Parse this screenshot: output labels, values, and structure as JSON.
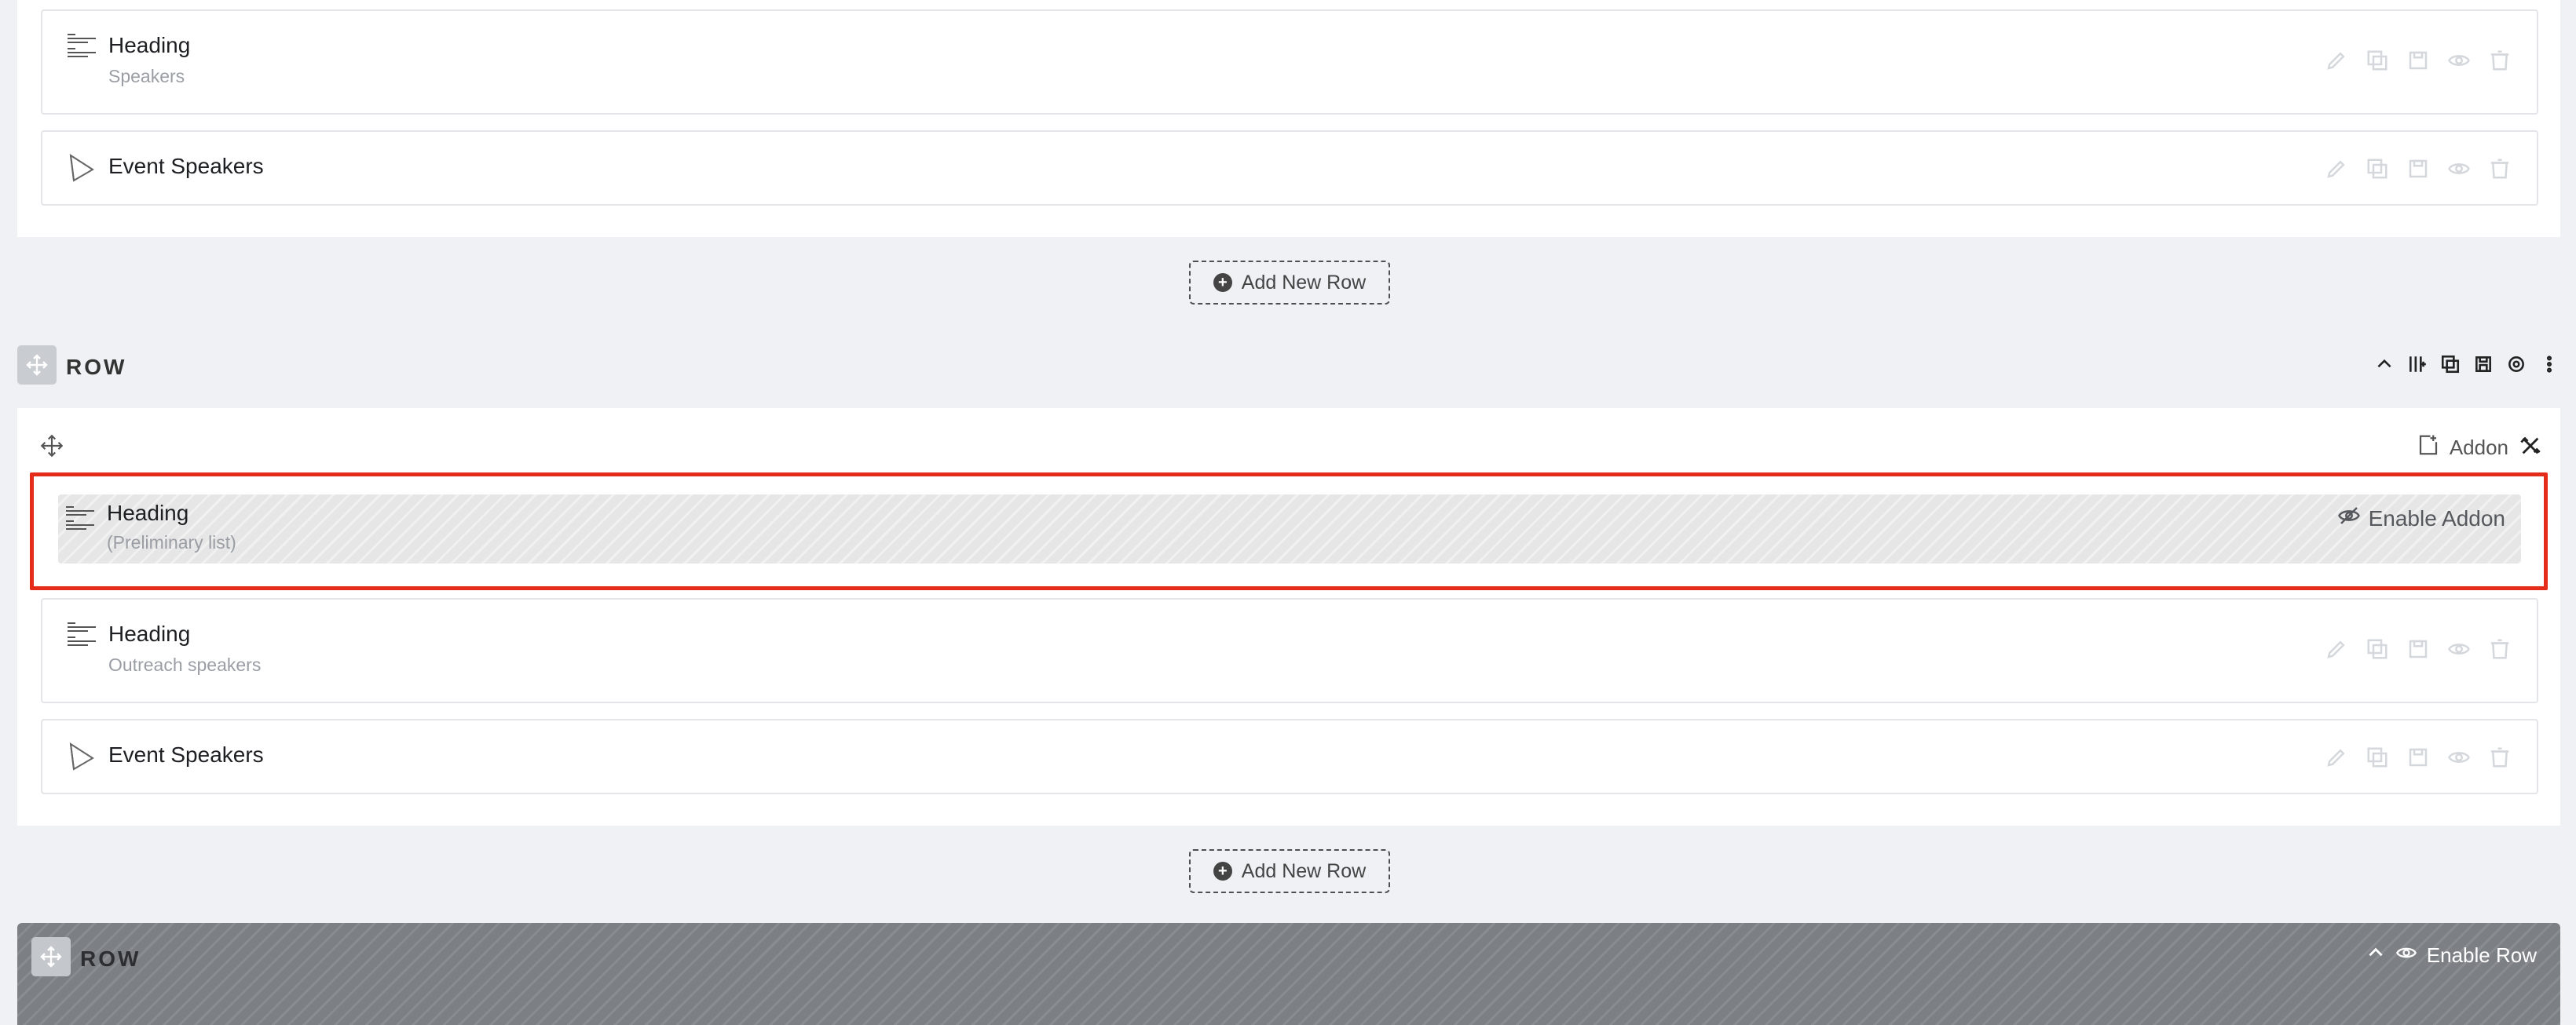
{
  "section1": {
    "addons": [
      {
        "title": "Heading",
        "subtitle": "Speakers",
        "icon": "heading-icon"
      },
      {
        "title": "Event Speakers",
        "subtitle": "",
        "icon": "event-speakers-icon"
      }
    ]
  },
  "add_row_label": "Add New Row",
  "row2": {
    "label": "ROW",
    "addon_button_label": "Addon",
    "disabled_addon": {
      "title": "Heading",
      "subtitle": "(Preliminary list)",
      "enable_label": "Enable Addon"
    },
    "addons": [
      {
        "title": "Heading",
        "subtitle": "Outreach speakers",
        "icon": "heading-icon"
      },
      {
        "title": "Event Speakers",
        "subtitle": "",
        "icon": "event-speakers-icon"
      }
    ]
  },
  "row3": {
    "label": "ROW",
    "enable_label": "Enable Row"
  },
  "colors": {
    "highlight": "#e52b1a",
    "disabled_row_bg": "#7c8085",
    "page_bg": "#eff1f4"
  }
}
